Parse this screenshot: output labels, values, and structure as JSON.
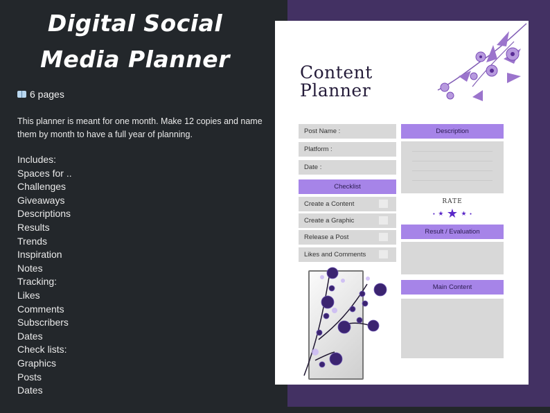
{
  "left_panel": {
    "title_line1": "Digital Social",
    "title_line2": "Media Planner",
    "pages_icon": "open-book-icon",
    "pages_label": "6 pages",
    "description": "This planner is meant for one month. Make 12 copies and name them by month to have a full year of planning.",
    "includes": [
      "Includes:",
      "Spaces for ..",
      "Challenges",
      "Giveaways",
      "Descriptions",
      "Results",
      "Trends",
      "Inspiration",
      "Notes",
      "Tracking:",
      "Likes",
      "Comments",
      "Subscribers",
      "Dates",
      "Check lists:",
      "Graphics",
      "Posts",
      "Dates"
    ]
  },
  "planner": {
    "title_line1": "Content",
    "title_line2": "Planner",
    "fields": [
      "Post Name :",
      "Platform :",
      "Date :"
    ],
    "checklist_header": "Checklist",
    "checklist_items": [
      "Create a Content",
      "Create a Graphic",
      "Release a Post",
      "Likes and Comments"
    ],
    "description_header": "Description",
    "rate_label": "RATE",
    "result_header": "Result / Evaluation",
    "main_content_header": "Main Content"
  },
  "colors": {
    "background_dark": "#23272b",
    "panel_purple": "#433163",
    "accent_lavender": "#a684e8",
    "field_gray": "#d8d8d8",
    "star_purple": "#5a28c8"
  }
}
